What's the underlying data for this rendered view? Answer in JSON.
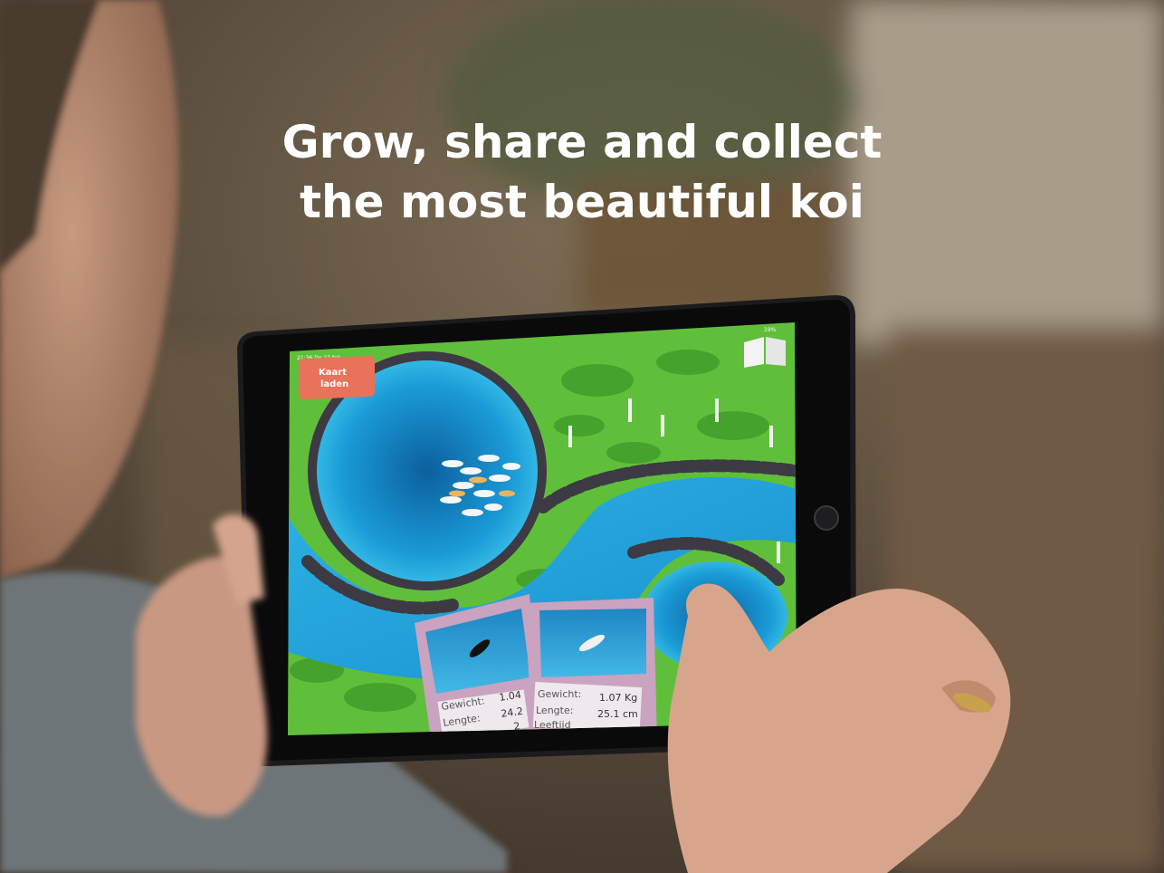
{
  "headline": {
    "line1": "Grow, share and collect",
    "line2": "the most beautiful koi"
  },
  "game": {
    "load_card_button": "Kaart laden",
    "load_card_line1": "Kaart",
    "load_card_line2": "laden",
    "status_time": "21:36  Do 27 feb",
    "status_battery": "19%",
    "book_icon": "open-book-icon"
  },
  "cards": [
    {
      "weight_label": "Gewicht:",
      "weight_value": "1.04",
      "length_label": "Lengte:",
      "length_value": "24.2",
      "age_value": "2"
    },
    {
      "weight_label": "Gewicht:",
      "weight_value": "1.07 Kg",
      "length_label": "Lengte:",
      "length_value": "25.1 cm",
      "age_label": "Leeftijd"
    }
  ],
  "colors": {
    "grass": "#5fbf3a",
    "water": "#1fa3d8",
    "load_button": "#e8725a",
    "card_frame": "#c9a3c0"
  }
}
